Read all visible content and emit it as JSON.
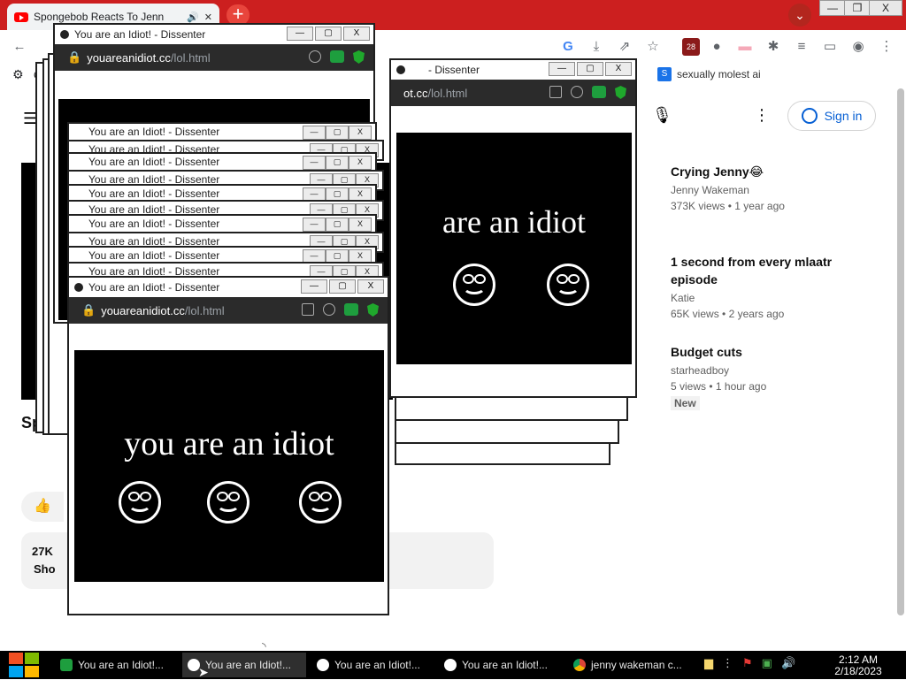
{
  "browser": {
    "tab_title": "Spongebob Reacts To Jenn",
    "new_tab": "+",
    "minimize": "—",
    "restore": "❐",
    "close": "X",
    "extension_badge": "28",
    "bookmark_label": "sexually molest ai",
    "bookmark_prefix": "G"
  },
  "youtube": {
    "hamburger": "☰",
    "signin_label": "Sign in",
    "recommendations": [
      {
        "title": "Crying Jenny😂",
        "channel": "Jenny Wakeman",
        "views": "373K views",
        "age": "1 year ago"
      },
      {
        "title": "1 second from every mlaatr episode",
        "channel": "Katie",
        "views": "65K views",
        "age": "2 years ago"
      },
      {
        "title": "Budget cuts",
        "channel": "starheadboy",
        "views": "5 views",
        "age": "1 hour ago",
        "badge": "New"
      }
    ],
    "video_title_fragment": "Sp",
    "desc_views_fragment": "27K",
    "desc_more_fragment": "Sho"
  },
  "popup": {
    "title": "You are an Idiot! - Dissenter",
    "title_short": "- Dissenter",
    "url_domain": "youareanidiot.cc",
    "url_path": "/lol.html",
    "url_partial": "ot.cc",
    "message": "you are an idiot",
    "message_partial": "are an idiot",
    "stack_titles": [
      "You are an Idiot! - Dissenter",
      "You are an Idiot! - Dissenter",
      "You are an Idiot! - Dissenter",
      "You are an Idiot! - Dissenter",
      "You are an Idiot! - Dissenter",
      "You are an Idiot! - Dissenter",
      "You are an Idiot! - Dissenter",
      "You are an Idiot! - Dissenter",
      "You are an Idiot! - Dissenter",
      "You are an Idiot! - Dissenter"
    ]
  },
  "taskbar": {
    "tasks": [
      {
        "label": "You are an Idiot!...",
        "icon": "dissenter-icon"
      },
      {
        "label": "You are an Idiot!...",
        "icon": "smiley-icon"
      },
      {
        "label": "You are an Idiot!...",
        "icon": "smiley-icon"
      },
      {
        "label": "You are an Idiot!...",
        "icon": "smiley-icon"
      },
      {
        "label": "jenny wakeman c...",
        "icon": "chrome-icon"
      }
    ],
    "time": "2:12 AM",
    "date": "2/18/2023"
  },
  "colors": {
    "tabstrip": "#cc1f1f",
    "youtube_link": "#065fd4",
    "dissenter_green": "#1e9e3e"
  }
}
